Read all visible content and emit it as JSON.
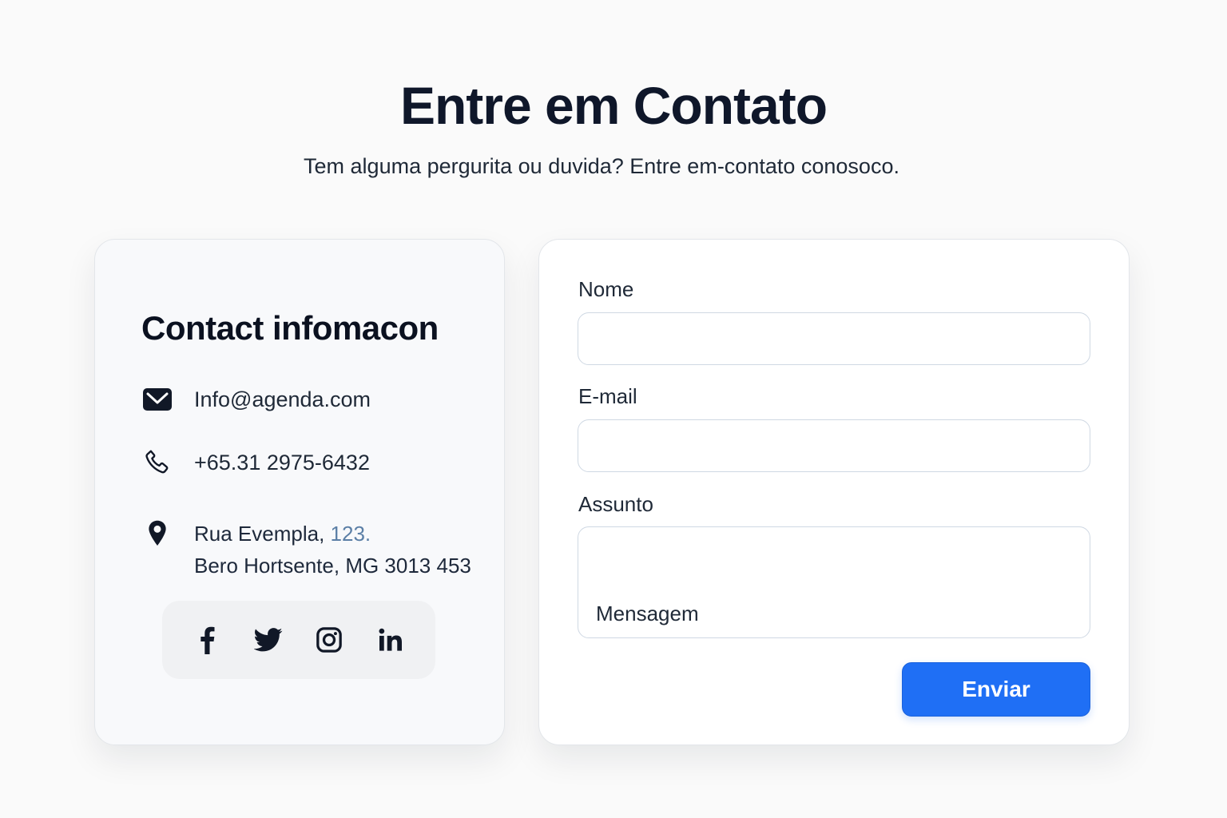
{
  "header": {
    "title": "Entre em Contato",
    "subtitle": "Tem alguma pergurita ou duvida? Entre em-contato conosoco."
  },
  "info": {
    "title": "Contact infomacon",
    "email": "Info@agenda.com",
    "phone": "+65.31 2975-6432",
    "address_line1_street": "Rua Evempla, ",
    "address_line1_number": "123.",
    "address_line2": "Bero Hortsente, MG 3013 453",
    "social": [
      "facebook-icon",
      "twitter-icon",
      "instagram-icon",
      "linkedin-icon"
    ]
  },
  "form": {
    "name_label": "Nome",
    "name_value": "",
    "email_label": "E-mail",
    "email_value": "",
    "subject_label": "Assunto",
    "subject_value": "",
    "message_placeholder": "Mensagem",
    "submit_label": "Enviar"
  },
  "colors": {
    "accent": "#1f6ff5",
    "text": "#111827",
    "address_number": "#5b7fa6"
  }
}
